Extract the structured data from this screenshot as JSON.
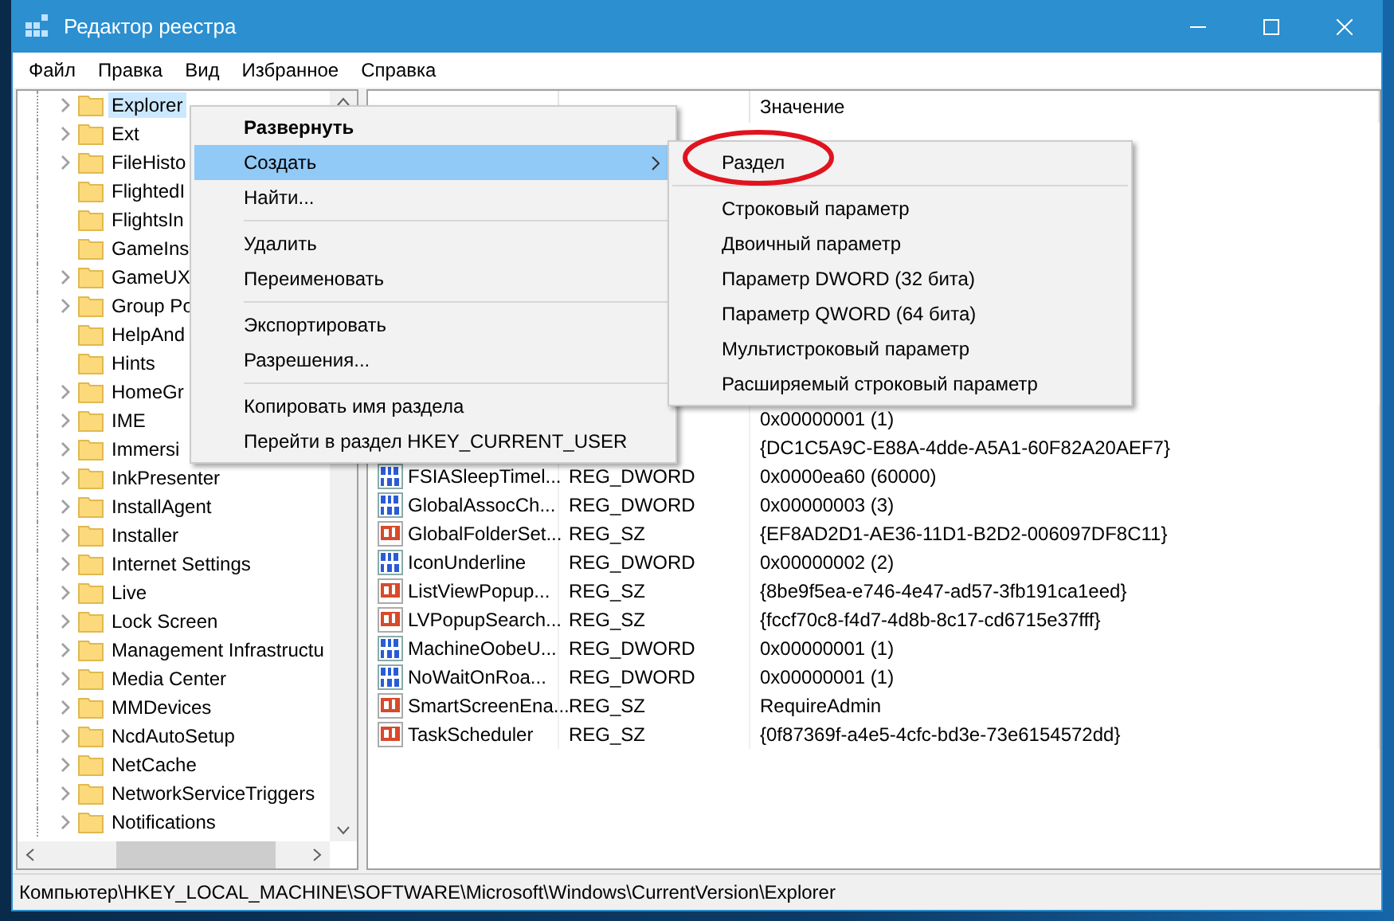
{
  "window": {
    "title": "Редактор реестра"
  },
  "menu_bar": [
    "Файл",
    "Правка",
    "Вид",
    "Избранное",
    "Справка"
  ],
  "tree": {
    "items": [
      {
        "label": "Explorer",
        "has_children": true,
        "selected": true
      },
      {
        "label": "Ext",
        "has_children": true,
        "selected": false
      },
      {
        "label": "FileHisto",
        "has_children": true,
        "selected": false
      },
      {
        "label": "FlightedI",
        "has_children": false,
        "selected": false
      },
      {
        "label": "FlightsIn",
        "has_children": false,
        "selected": false
      },
      {
        "label": "GameIns",
        "has_children": false,
        "selected": false
      },
      {
        "label": "GameUX",
        "has_children": true,
        "selected": false
      },
      {
        "label": "Group Po",
        "has_children": true,
        "selected": false
      },
      {
        "label": "HelpAnd",
        "has_children": false,
        "selected": false
      },
      {
        "label": "Hints",
        "has_children": false,
        "selected": false
      },
      {
        "label": "HomeGr",
        "has_children": true,
        "selected": false
      },
      {
        "label": "IME",
        "has_children": true,
        "selected": false
      },
      {
        "label": "Immersi",
        "has_children": true,
        "selected": false
      },
      {
        "label": "InkPresenter",
        "has_children": true,
        "selected": false
      },
      {
        "label": "InstallAgent",
        "has_children": true,
        "selected": false
      },
      {
        "label": "Installer",
        "has_children": true,
        "selected": false
      },
      {
        "label": "Internet Settings",
        "has_children": true,
        "selected": false
      },
      {
        "label": "Live",
        "has_children": true,
        "selected": false
      },
      {
        "label": "Lock Screen",
        "has_children": true,
        "selected": false
      },
      {
        "label": "Management Infrastructu",
        "has_children": true,
        "selected": false
      },
      {
        "label": "Media Center",
        "has_children": true,
        "selected": false
      },
      {
        "label": "MMDevices",
        "has_children": true,
        "selected": false
      },
      {
        "label": "NcdAutoSetup",
        "has_children": true,
        "selected": false
      },
      {
        "label": "NetCache",
        "has_children": true,
        "selected": false
      },
      {
        "label": "NetworkServiceTriggers",
        "has_children": true,
        "selected": false
      },
      {
        "label": "Notifications",
        "has_children": true,
        "selected": false
      }
    ]
  },
  "list": {
    "columns": [
      "Значение"
    ],
    "rows": [
      {
        "value": "0x00000001 (1)"
      },
      {
        "value": "{DC1C5A9C-E88A-4dde-A5A1-60F82A20AEF7}"
      },
      {
        "kind": "binary",
        "name": "FSIASleepTimel...",
        "type": "REG_DWORD",
        "value": "0x0000ea60 (60000)"
      },
      {
        "kind": "binary",
        "name": "GlobalAssocCh...",
        "type": "REG_DWORD",
        "value": "0x00000003 (3)"
      },
      {
        "kind": "string",
        "name": "GlobalFolderSet...",
        "type": "REG_SZ",
        "value": "{EF8AD2D1-AE36-11D1-B2D2-006097DF8C11}"
      },
      {
        "kind": "binary",
        "name": "IconUnderline",
        "type": "REG_DWORD",
        "value": "0x00000002 (2)"
      },
      {
        "kind": "string",
        "name": "ListViewPopup...",
        "type": "REG_SZ",
        "value": "{8be9f5ea-e746-4e47-ad57-3fb191ca1eed}"
      },
      {
        "kind": "string",
        "name": "LVPopupSearch...",
        "type": "REG_SZ",
        "value": "{fccf70c8-f4d7-4d8b-8c17-cd6715e37fff}"
      },
      {
        "kind": "binary",
        "name": "MachineOobeU...",
        "type": "REG_DWORD",
        "value": "0x00000001 (1)"
      },
      {
        "kind": "binary",
        "name": "NoWaitOnRoa...",
        "type": "REG_DWORD",
        "value": "0x00000001 (1)"
      },
      {
        "kind": "string",
        "name": "SmartScreenEna...",
        "type": "REG_SZ",
        "value": "RequireAdmin"
      },
      {
        "kind": "string",
        "name": "TaskScheduler",
        "type": "REG_SZ",
        "value": "{0f87369f-a4e5-4cfc-bd3e-73e6154572dd}"
      }
    ]
  },
  "context_menu": {
    "groups": [
      [
        {
          "label": "Развернуть",
          "default": true,
          "selected": false,
          "has_submenu": false
        },
        {
          "label": "Создать",
          "default": false,
          "selected": true,
          "has_submenu": true
        },
        {
          "label": "Найти...",
          "default": false,
          "selected": false,
          "has_submenu": false
        }
      ],
      [
        {
          "label": "Удалить",
          "default": false,
          "selected": false,
          "has_submenu": false
        },
        {
          "label": "Переименовать",
          "default": false,
          "selected": false,
          "has_submenu": false
        }
      ],
      [
        {
          "label": "Экспортировать",
          "default": false,
          "selected": false,
          "has_submenu": false
        },
        {
          "label": "Разрешения...",
          "default": false,
          "selected": false,
          "has_submenu": false
        }
      ],
      [
        {
          "label": "Копировать имя раздела",
          "default": false,
          "selected": false,
          "has_submenu": false
        },
        {
          "label": "Перейти в раздел HKEY_CURRENT_USER",
          "default": false,
          "selected": false,
          "has_submenu": false
        }
      ]
    ]
  },
  "submenu": {
    "groups": [
      [
        {
          "label": "Раздел",
          "circled": true
        }
      ],
      [
        {
          "label": "Строковый параметр",
          "circled": false
        },
        {
          "label": "Двоичный параметр",
          "circled": false
        },
        {
          "label": "Параметр DWORD (32 бита)",
          "circled": false
        },
        {
          "label": "Параметр QWORD (64 бита)",
          "circled": false
        },
        {
          "label": "Мультистроковый параметр",
          "circled": false
        },
        {
          "label": "Расширяемый строковый параметр",
          "circled": false
        }
      ]
    ]
  },
  "status_bar": "Компьютер\\HKEY_LOCAL_MACHINE\\SOFTWARE\\Microsoft\\Windows\\CurrentVersion\\Explorer"
}
